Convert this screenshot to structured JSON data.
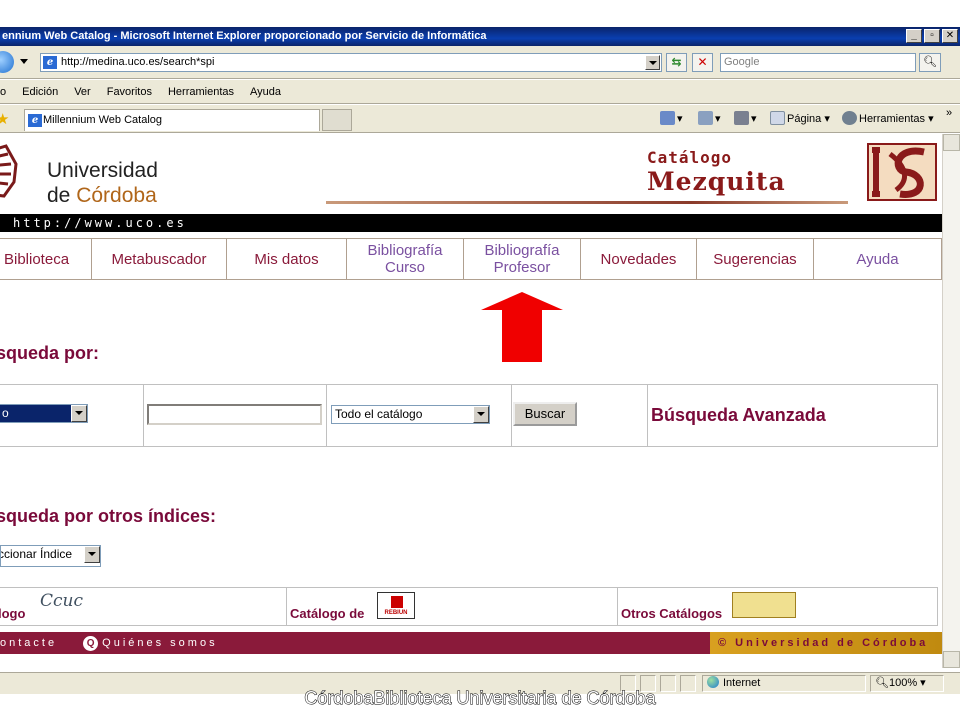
{
  "window": {
    "title": "ennium Web Catalog - Microsoft Internet Explorer proporcionado por Servicio de Informática",
    "buttons": [
      "_",
      "▫",
      "✕"
    ]
  },
  "address_bar": {
    "url": "http://medina.uco.es/search*spi",
    "search_placeholder": "Google"
  },
  "menu": [
    "o",
    "Edición",
    "Ver",
    "Favoritos",
    "Herramientas",
    "Ayuda"
  ],
  "tab": {
    "label": "Millennium Web Catalog"
  },
  "command_bar": {
    "pagina": "Página",
    "herramientas": "Herramientas",
    "overflow": "»"
  },
  "header": {
    "uni_line1": "Universidad",
    "uni_line2_prefix": "de ",
    "uni_line2_accent": "Córdoba",
    "catalogo_small": "Catálogo",
    "catalogo_big": "Mezquita",
    "url_strip": "http://www.uco.es"
  },
  "nav": [
    {
      "label": "Biblioteca",
      "style": "plain"
    },
    {
      "label": "Metabuscador",
      "style": "plain"
    },
    {
      "label": "Mis datos",
      "style": "plain"
    },
    {
      "label": "Bibliografía Curso",
      "style": "purple"
    },
    {
      "label": "Bibliografía Profesor",
      "style": "purple"
    },
    {
      "label": "Novedades",
      "style": "plain"
    },
    {
      "label": "Sugerencias",
      "style": "plain"
    },
    {
      "label": "Ayuda",
      "style": "purple"
    }
  ],
  "search": {
    "title": "squeda por:",
    "type_value": "o",
    "term_value": "",
    "scope_value": "Todo el catálogo",
    "button": "Buscar",
    "advanced": "Búsqueda Avanzada"
  },
  "other_indexes": {
    "title": "squeda por otros índices:",
    "select_value": "ccionar Índice"
  },
  "catalogs": {
    "c1": "logo",
    "c1_logo": "Ccuc",
    "c2": "Catálogo de",
    "c2_logo": "REBIUN",
    "c3": "Otros Catálogos"
  },
  "footer": {
    "contacte": "ontacte",
    "quienes_icon": "Q",
    "quienes": "Quiénes somos",
    "copyright": "© Universidad de Córdoba"
  },
  "status": {
    "zone": "Internet",
    "zoom": "100%"
  },
  "caption": {
    "text": "CórdobaBiblioteca Universitaria de Córdoba"
  },
  "colors": {
    "brand": "#8a1a3a",
    "accent": "#b0661a",
    "titlebar": "#0a246a"
  }
}
